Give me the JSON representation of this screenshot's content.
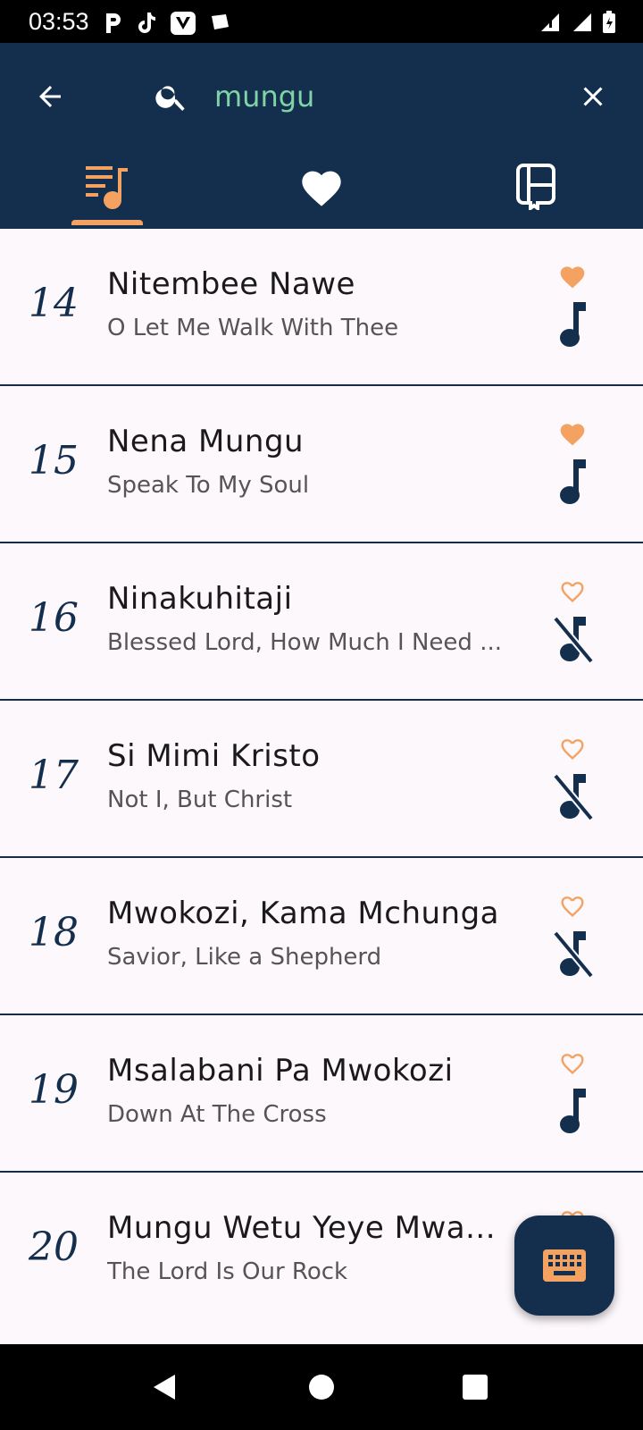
{
  "status_bar": {
    "time": "03:53",
    "left_icons": [
      "parking-icon",
      "tiktok-icon",
      "v-app-icon",
      "notification-icon"
    ],
    "right_icons": [
      "signal-icon",
      "wifi-icon",
      "battery-icon"
    ]
  },
  "app_bar": {
    "search": {
      "value": "mungu",
      "placeholder": ""
    },
    "tabs": [
      {
        "name": "song-list",
        "icon": "playlist-icon",
        "selected": true
      },
      {
        "name": "favorites",
        "icon": "heart-icon",
        "selected": false
      },
      {
        "name": "books",
        "icon": "book-icon",
        "selected": false
      }
    ]
  },
  "colors": {
    "primary": "#142f4d",
    "accent": "#f4a261",
    "search_text": "#7fd3a6",
    "background": "#fdf8fc"
  },
  "songs": [
    {
      "number": "14",
      "title": "Nitembee Nawe",
      "subtitle": "O Let Me Walk With Thee",
      "favorite": true,
      "has_audio": true
    },
    {
      "number": "15",
      "title": "Nena Mungu",
      "subtitle": "Speak To My Soul",
      "favorite": true,
      "has_audio": true
    },
    {
      "number": "16",
      "title": "Ninakuhitaji",
      "subtitle": "Blessed Lord, How Much I Need ...",
      "favorite": false,
      "has_audio": false
    },
    {
      "number": "17",
      "title": "Si Mimi Kristo",
      "subtitle": "Not I, But Christ",
      "favorite": false,
      "has_audio": false
    },
    {
      "number": "18",
      "title": "Mwokozi, Kama Mchunga",
      "subtitle": "Savior, Like a Shepherd",
      "favorite": false,
      "has_audio": false
    },
    {
      "number": "19",
      "title": "Msalabani Pa Mwokozi",
      "subtitle": "Down At The Cross",
      "favorite": false,
      "has_audio": true
    },
    {
      "number": "20",
      "title": "Mungu Wetu Yeye Mwa...",
      "subtitle": "The Lord Is Our Rock",
      "favorite": false,
      "has_audio": true
    }
  ],
  "fab": {
    "icon": "keyboard-icon"
  },
  "nav_bar": {
    "icons": [
      "back-icon",
      "home-icon",
      "recents-icon"
    ]
  }
}
